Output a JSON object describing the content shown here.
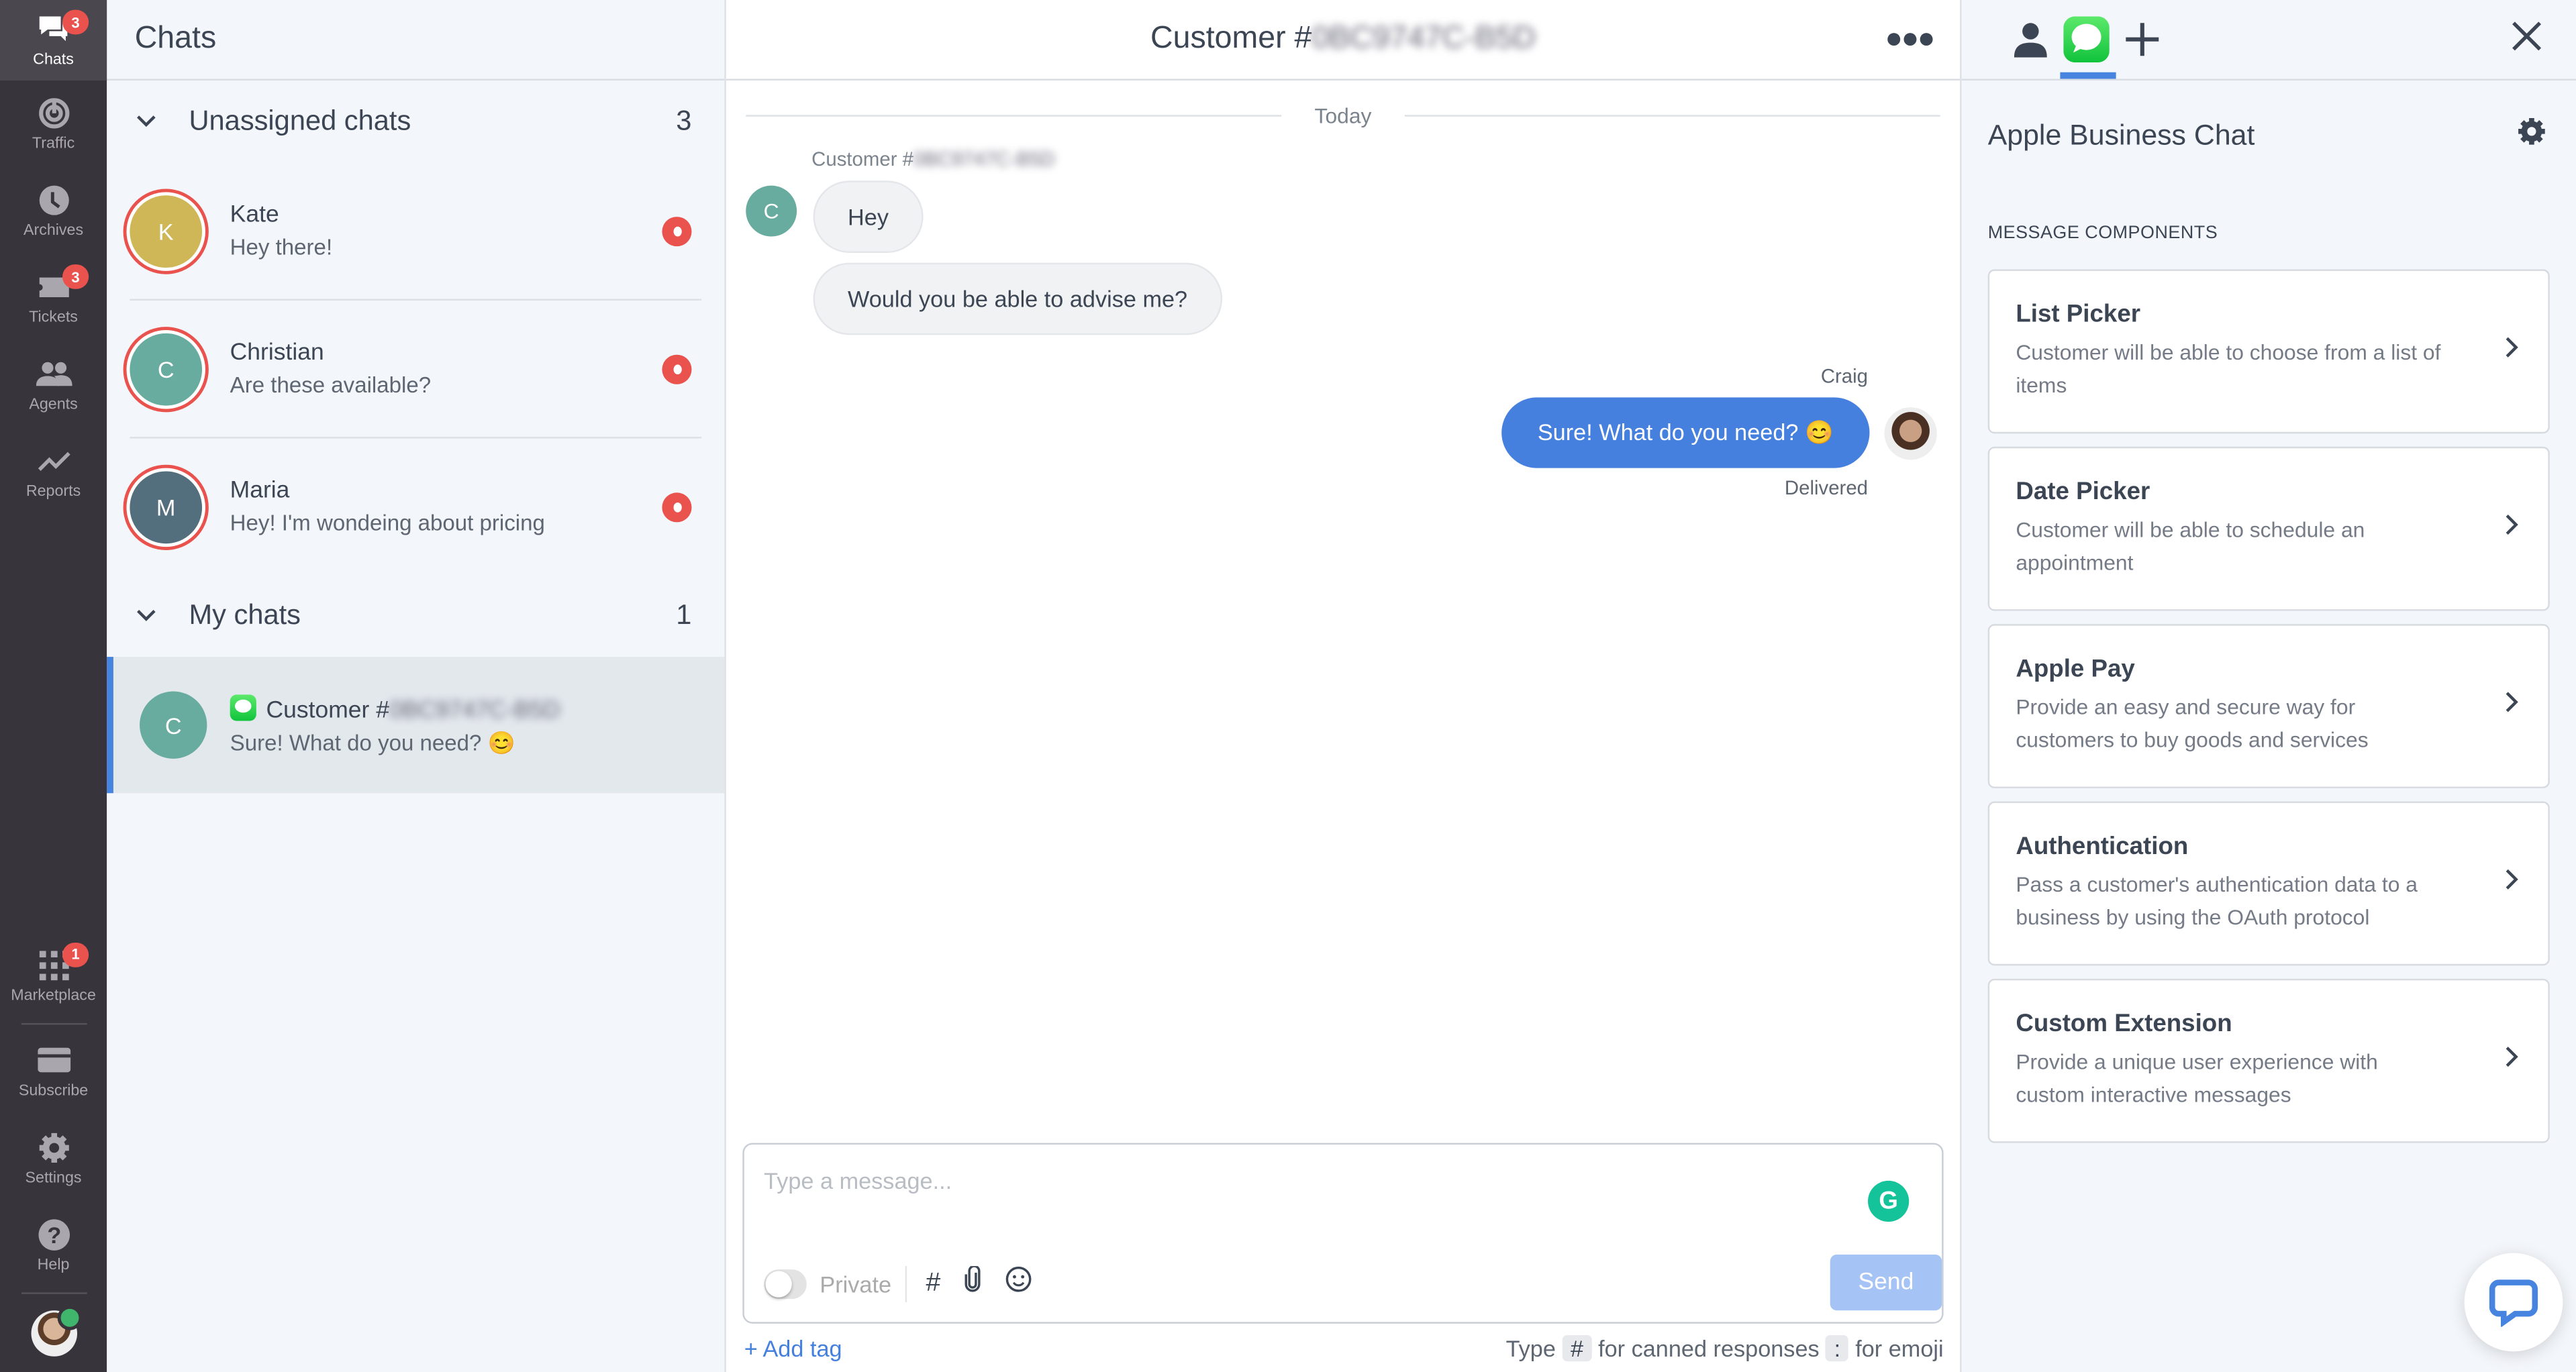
{
  "nav": {
    "items": [
      {
        "label": "Chats",
        "icon": "chat-bubbles-icon",
        "badge": "3",
        "active": true
      },
      {
        "label": "Traffic",
        "icon": "traffic-radar-icon"
      },
      {
        "label": "Archives",
        "icon": "clock-icon"
      },
      {
        "label": "Tickets",
        "icon": "ticket-icon",
        "badge": "3"
      },
      {
        "label": "Agents",
        "icon": "agents-icon"
      },
      {
        "label": "Reports",
        "icon": "trend-line-icon"
      }
    ],
    "bottom_items": [
      {
        "label": "Marketplace",
        "icon": "grid-icon",
        "badge": "1"
      },
      {
        "label": "Subscribe",
        "icon": "credit-card-icon"
      },
      {
        "label": "Settings",
        "icon": "gear-icon"
      },
      {
        "label": "Help",
        "icon": "question-icon"
      }
    ]
  },
  "chat_list": {
    "title": "Chats",
    "unassigned": {
      "label": "Unassigned chats",
      "count": "3",
      "items": [
        {
          "initial": "K",
          "name": "Kate",
          "message": "Hey there!",
          "color": "#cfb656"
        },
        {
          "initial": "C",
          "name": "Christian",
          "message": "Are these available?",
          "color": "#68ab9f"
        },
        {
          "initial": "M",
          "name": "Maria",
          "message": "Hey! I'm wondeing about pricing",
          "color": "#536f7d"
        }
      ]
    },
    "mine": {
      "label": "My chats",
      "count": "1",
      "items": [
        {
          "initial": "C",
          "name_prefix": "Customer #",
          "name_redacted": "0BC9747C-B5D",
          "message": "Sure! What do you need? 😊",
          "color": "#68ab9f"
        }
      ]
    }
  },
  "conversation": {
    "title_prefix": "Customer #",
    "title_redacted": "0BC9747C-B5D",
    "date_divider": "Today",
    "customer": {
      "initial": "C",
      "name_prefix": "Customer #",
      "name_redacted": "0BC9747C-B5D",
      "messages": [
        "Hey",
        "Would you be able to advise me?"
      ]
    },
    "agent": {
      "name": "Craig",
      "message": "Sure! What do you need? 😊",
      "status": "Delivered"
    }
  },
  "composer": {
    "placeholder": "Type a message...",
    "private_label": "Private",
    "send_label": "Send",
    "grammarly": "G",
    "add_tag": "+ Add tag",
    "hint": {
      "type": "Type",
      "hash": "#",
      "canned": "for canned responses",
      "colon": ":",
      "emoji": "for emoji"
    }
  },
  "side_panel": {
    "title": "Apple Business Chat",
    "section_label": "MESSAGE COMPONENTS",
    "cards": [
      {
        "title": "List Picker",
        "desc": "Customer will be able to choose from a list of items"
      },
      {
        "title": "Date Picker",
        "desc": "Customer will be able to schedule an appointment"
      },
      {
        "title": "Apple Pay",
        "desc": "Provide an easy and secure way for customers to buy goods and services"
      },
      {
        "title": "Authentication",
        "desc": "Pass a customer's authentication data to a business by using the OAuth protocol"
      },
      {
        "title": "Custom Extension",
        "desc": "Provide a unique user experience with custom interactive messages"
      }
    ]
  },
  "colors": {
    "accent": "#4680df",
    "badge": "#e9524d",
    "nav_bg": "#38343c",
    "imessage_green": "#11c33c"
  }
}
